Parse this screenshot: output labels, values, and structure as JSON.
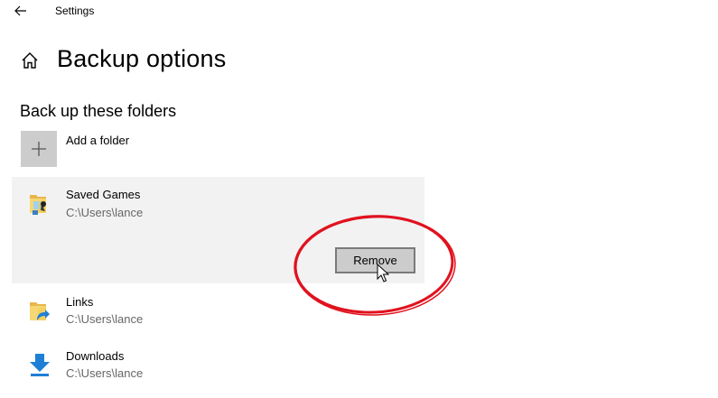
{
  "window": {
    "title": "Settings"
  },
  "header": {
    "page_title": "Backup options"
  },
  "section": {
    "title": "Back up these folders"
  },
  "add_folder": {
    "label": "Add a folder"
  },
  "folders": [
    {
      "name": "Saved Games",
      "path": "C:\\Users\\lance",
      "icon": "saved-games-folder-icon",
      "selected": true,
      "action_label": "Remove"
    },
    {
      "name": "Links",
      "path": "C:\\Users\\lance",
      "icon": "links-folder-icon",
      "selected": false
    },
    {
      "name": "Downloads",
      "path": "C:\\Users\\lance",
      "icon": "downloads-folder-icon",
      "selected": false
    }
  ],
  "colors": {
    "highlight_ellipse": "#e0121e",
    "selected_row_bg": "#f2f2f2",
    "add_tile_bg": "#cccccc",
    "secondary_text": "#666666",
    "download_arrow": "#1f7fd6"
  }
}
